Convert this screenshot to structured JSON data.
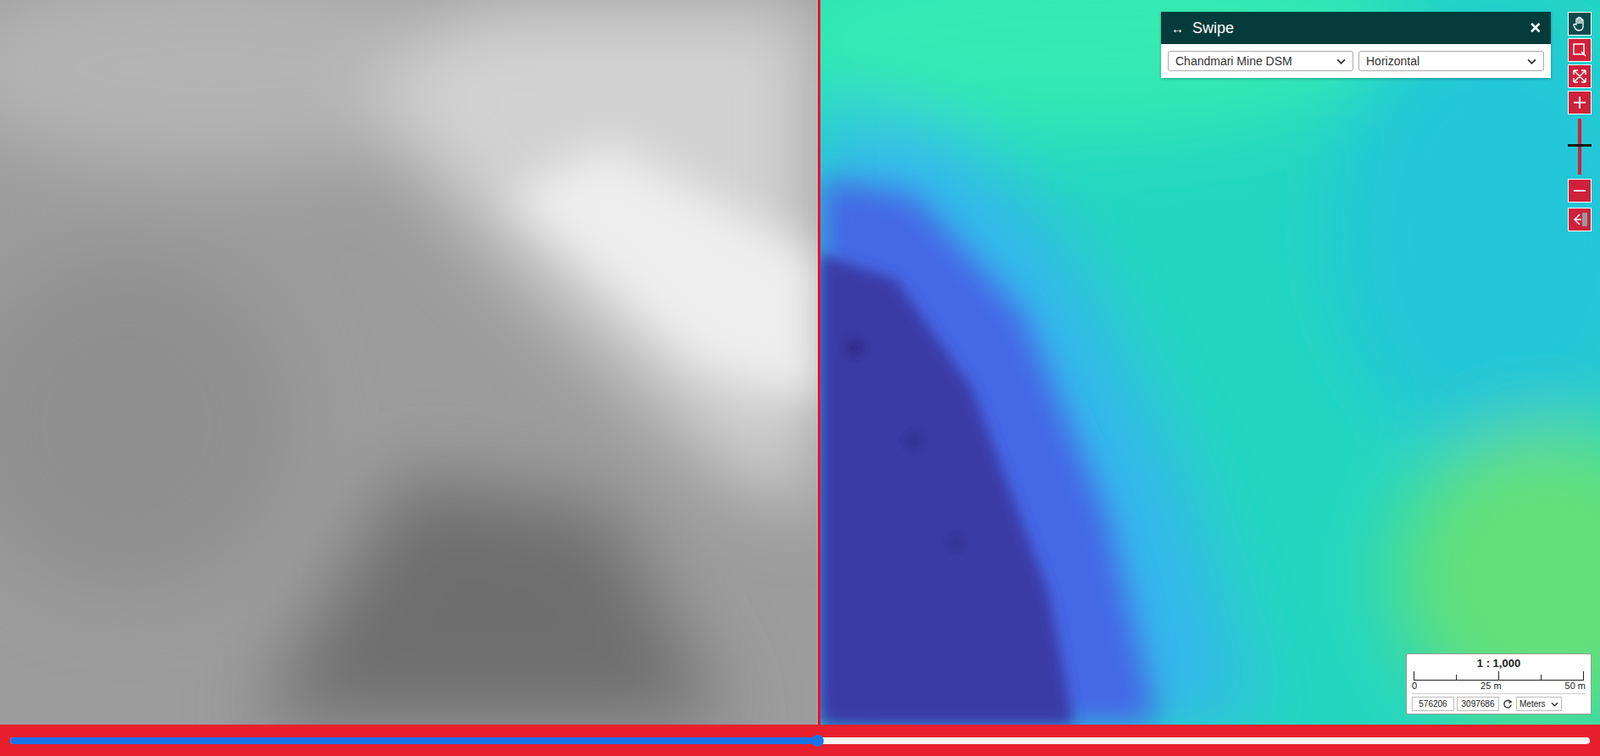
{
  "swipe_panel": {
    "icon": "↔",
    "title": "Swipe",
    "close": "×",
    "layer": "Chandmari Mine DSM",
    "orientation": "Horizontal"
  },
  "toolbar": {
    "pan_selected": true,
    "zoom_level": 0.55
  },
  "scale": {
    "ratio": "1 : 1,000",
    "ticks": [
      "0",
      "25 m",
      "50 m"
    ]
  },
  "coordinates": {
    "x": "576206",
    "y": "3097686"
  },
  "units": "Meters",
  "swipe": {
    "level": 0.511
  }
}
